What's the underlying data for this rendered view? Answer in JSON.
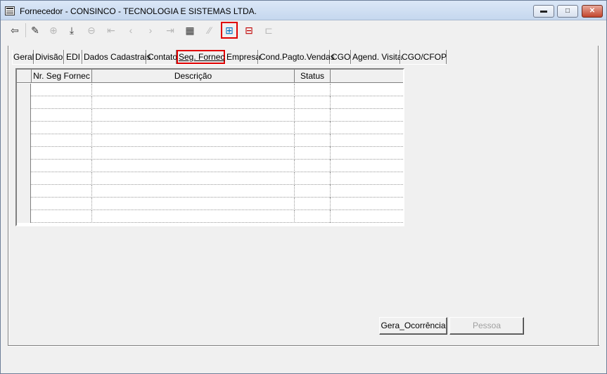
{
  "window": {
    "title": "Fornecedor - CONSINCO - TECNOLOGIA E SISTEMAS LTDA.",
    "minimize_glyph": "▬",
    "maximize_glyph": "□",
    "close_glyph": "✕"
  },
  "toolbar": {
    "buttons": [
      {
        "name": "exit-icon",
        "glyph": "⇦",
        "disabled": false
      },
      {
        "name": "eraser-icon",
        "glyph": "✎",
        "disabled": false
      },
      {
        "name": "insert-disabled-icon",
        "glyph": "⊕",
        "disabled": true
      },
      {
        "name": "save-icon",
        "glyph": "⤓",
        "disabled": false
      },
      {
        "name": "delete-disabled-icon",
        "glyph": "⊖",
        "disabled": true
      },
      {
        "name": "first-disabled-icon",
        "glyph": "⇤",
        "disabled": true
      },
      {
        "name": "prev-disabled-icon",
        "glyph": "‹",
        "disabled": true
      },
      {
        "name": "next-disabled-icon",
        "glyph": "›",
        "disabled": true
      },
      {
        "name": "last-disabled-icon",
        "glyph": "⇥",
        "disabled": true
      },
      {
        "name": "film-icon",
        "glyph": "▦",
        "disabled": false
      },
      {
        "name": "query-disabled-icon",
        "glyph": "⁄⁄",
        "disabled": true
      },
      {
        "name": "add-row-icon",
        "glyph": "⊞",
        "disabled": false
      },
      {
        "name": "remove-row-icon",
        "glyph": "⊟",
        "disabled": false
      },
      {
        "name": "layout-disabled-icon",
        "glyph": "⊏",
        "disabled": true
      }
    ]
  },
  "tabs": [
    "Geral",
    "Divisão",
    "EDI",
    "Dados Cadastrais",
    "Contato",
    "Seg. Fornec",
    "Empresa",
    "Cond.Pagto.Vendas",
    "CGO",
    "Agend. Visita",
    "CGO/CFOP"
  ],
  "active_tab": "Seg. Fornec",
  "grid": {
    "columns": [
      "Nr. Seg Fornec",
      "Descrição",
      "Status",
      ""
    ],
    "rows": 11
  },
  "buttons": {
    "gera_ocorrencia": "Gera_Ocorrência",
    "pessoa": "Pessoa"
  },
  "colors": {
    "highlight": "#e00000"
  }
}
